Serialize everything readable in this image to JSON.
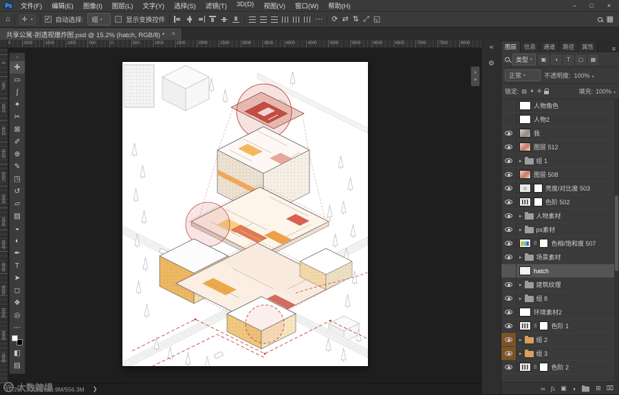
{
  "app": {
    "icon_text": "Ps",
    "menu_items": [
      {
        "id": "file",
        "label": "文件(F)"
      },
      {
        "id": "edit",
        "label": "编辑(E)"
      },
      {
        "id": "image",
        "label": "图像(I)"
      },
      {
        "id": "layer",
        "label": "图层(L)"
      },
      {
        "id": "type",
        "label": "文字(Y)"
      },
      {
        "id": "select",
        "label": "选择(S)"
      },
      {
        "id": "filter",
        "label": "滤镜(T)"
      },
      {
        "id": "3d",
        "label": "3D(D)"
      },
      {
        "id": "view",
        "label": "视图(V)"
      },
      {
        "id": "window",
        "label": "窗口(W)"
      },
      {
        "id": "help",
        "label": "帮助(H)"
      }
    ],
    "window_controls": [
      {
        "name": "minimize-button",
        "glyph": "–"
      },
      {
        "name": "maximize-button",
        "glyph": "□"
      },
      {
        "name": "close-button",
        "glyph": "×"
      }
    ]
  },
  "options_bar": {
    "home_glyph": "⌂",
    "tool_glyph": "✛",
    "auto_select_label": "自动选择:",
    "auto_select_checked": true,
    "scope_value": "组",
    "show_transform_label": "显示变换控件",
    "show_transform_checked": false,
    "more_glyph": "⋯",
    "align_icons": [
      {
        "name": "align-left-button"
      },
      {
        "name": "align-center-h-button"
      },
      {
        "name": "align-right-button"
      },
      {
        "name": "align-top-button"
      },
      {
        "name": "align-middle-button"
      },
      {
        "name": "align-bottom-button"
      }
    ],
    "distribute_icons": [
      {
        "name": "distribute-vertical-top-button"
      },
      {
        "name": "distribute-vertical-middle-button"
      },
      {
        "name": "distribute-vertical-bottom-button"
      },
      {
        "name": "distribute-horizontal-left-button"
      },
      {
        "name": "distribute-horizontal-center-button"
      },
      {
        "name": "distribute-horizontal-right-button"
      }
    ],
    "threed_icons": [
      {
        "name": "3d-rotate-icon",
        "glyph": "⟳"
      },
      {
        "name": "3d-roll-icon",
        "glyph": "⇄"
      },
      {
        "name": "3d-drag-icon",
        "glyph": "⇅"
      },
      {
        "name": "3d-slide-icon",
        "glyph": "⤢"
      },
      {
        "name": "3d-scale-icon",
        "glyph": "◱"
      }
    ],
    "right_icons": [
      {
        "name": "search-icon",
        "kind": "mag"
      },
      {
        "name": "workspace-switcher-icon",
        "glyph": "▦"
      }
    ]
  },
  "document_tab": {
    "title": "共享公寓-剖透视爆炸图.psd @ 15.2% (hatch, RGB/8) *",
    "close_glyph": "×"
  },
  "rulers": {
    "horizontal_labels": [
      "2500",
      "2000",
      "1500",
      "1000",
      "500",
      "0",
      "500",
      "1000",
      "1500",
      "2000",
      "2500",
      "3000",
      "3500",
      "4000",
      "4500",
      "5000",
      "5500",
      "6000",
      "6500",
      "7000",
      "7500",
      "8000"
    ],
    "vertical_labels": [
      "0",
      "500",
      "1000",
      "1500",
      "2000",
      "2500",
      "3000",
      "3500",
      "4000",
      "4500",
      "5000",
      "5500",
      "6000",
      "6500"
    ]
  },
  "tools": [
    {
      "name": "move-tool",
      "glyph": "✛",
      "active": true
    },
    {
      "name": "marquee-tool",
      "glyph": "▭"
    },
    {
      "name": "lasso-tool",
      "glyph": "ʃ"
    },
    {
      "name": "quick-selection-tool",
      "glyph": "✦"
    },
    {
      "name": "crop-tool",
      "glyph": "✂"
    },
    {
      "name": "frame-tool",
      "glyph": "⊠"
    },
    {
      "name": "eyedropper-tool",
      "glyph": "✐"
    },
    {
      "name": "healing-brush-tool",
      "glyph": "⊕"
    },
    {
      "name": "brush-tool",
      "glyph": "✎"
    },
    {
      "name": "clone-stamp-tool",
      "glyph": "◳"
    },
    {
      "name": "history-brush-tool",
      "glyph": "↺"
    },
    {
      "name": "eraser-tool",
      "glyph": "▱"
    },
    {
      "name": "gradient-tool",
      "glyph": "▨"
    },
    {
      "name": "blur-tool",
      "glyph": "◒"
    },
    {
      "name": "dodge-tool",
      "glyph": "◐"
    },
    {
      "name": "pen-tool",
      "glyph": "✒"
    },
    {
      "name": "type-tool",
      "glyph": "T"
    },
    {
      "name": "path-selection-tool",
      "glyph": "➤"
    },
    {
      "name": "rectangle-tool",
      "glyph": "◻"
    },
    {
      "name": "hand-tool",
      "glyph": "❖"
    },
    {
      "name": "zoom-tool",
      "glyph": "◎"
    },
    {
      "name": "edit-toolbar-button",
      "glyph": "⋯"
    },
    {
      "name": "color-swatches",
      "kind": "swatches"
    },
    {
      "name": "quick-mask-button",
      "glyph": "◧"
    },
    {
      "name": "screen-mode-button",
      "glyph": "▤"
    }
  ],
  "canvas_widget_icons": [
    {
      "name": "collapse-widget-icon",
      "glyph": "»"
    },
    {
      "name": "widget-options-icon",
      "glyph": "≡"
    }
  ],
  "panels": {
    "dock_strip": [
      {
        "name": "collapse-dock-button",
        "glyph": "«"
      },
      {
        "name": "properties-panel-icon",
        "glyph": "⚙"
      }
    ],
    "tabs": [
      {
        "label": "图层",
        "active": true
      },
      {
        "label": "信息",
        "active": false
      },
      {
        "label": "通道",
        "active": false
      },
      {
        "label": "路径",
        "active": false
      },
      {
        "label": "属性",
        "active": false
      }
    ],
    "panel_menu_glyph": "≡",
    "filter_row": {
      "type_label": "类型",
      "filters": [
        {
          "name": "pixel-filter-icon",
          "glyph": "▣"
        },
        {
          "name": "adjustment-filter-icon",
          "glyph": "◑"
        },
        {
          "name": "type-filter-icon",
          "glyph": "T"
        },
        {
          "name": "shape-filter-icon",
          "glyph": "▢"
        },
        {
          "name": "smart-object-filter-icon",
          "glyph": "▦"
        }
      ]
    },
    "blend_row": {
      "mode": "正常",
      "opacity_label": "不透明度:",
      "opacity_value": "100%"
    },
    "lock_row": {
      "label": "锁定:",
      "icons": [
        {
          "name": "lock-transparency-icon",
          "glyph": "▨"
        },
        {
          "name": "lock-paint-icon",
          "glyph": "✦"
        },
        {
          "name": "lock-position-icon",
          "glyph": "✛"
        },
        {
          "name": "lock-all-icon",
          "kind": "padlock"
        }
      ],
      "fill_label": "填充:",
      "fill_value": "100%"
    },
    "layers": [
      {
        "name": "人物角色",
        "type": "layer",
        "thumb": "white",
        "visible": false
      },
      {
        "name": "人物2",
        "type": "layer",
        "thumb": "white",
        "visible": false
      },
      {
        "name": "我",
        "type": "layer",
        "thumb": "image",
        "visible": true
      },
      {
        "name": "图层 512",
        "type": "layer",
        "thumb": "image2",
        "visible": true
      },
      {
        "name": "组 1",
        "type": "group",
        "visible": true
      },
      {
        "name": "图层 508",
        "type": "layer",
        "thumb": "image2",
        "visible": true
      },
      {
        "name": "亮度/对比度 503",
        "type": "adjustment",
        "adj": "sun",
        "mask": true,
        "visible": true
      },
      {
        "name": "色阶 502",
        "type": "adjustment",
        "adj": "levels",
        "mask": true,
        "visible": true
      },
      {
        "name": "人物素材",
        "type": "group",
        "visible": true
      },
      {
        "name": "ps素材",
        "type": "group",
        "visible": true
      },
      {
        "name": "色相/饱和度 507",
        "type": "adjustment",
        "adj": "hue",
        "mask": true,
        "linked": true,
        "visible": true
      },
      {
        "name": "场景素材",
        "type": "group",
        "visible": true
      },
      {
        "name": "hatch",
        "type": "layer",
        "thumb": "hatch",
        "visible": false,
        "selected": true
      },
      {
        "name": "建筑纹理",
        "type": "group",
        "visible": true
      },
      {
        "name": "组 8",
        "type": "group",
        "visible": true
      },
      {
        "name": "环境素材2",
        "type": "layer",
        "thumb": "white",
        "visible": true
      },
      {
        "name": "色阶 1",
        "type": "adjustment",
        "adj": "levels",
        "mask": true,
        "linked": true,
        "visible": true
      },
      {
        "name": "组 2",
        "type": "group",
        "visible": true,
        "label_color": "orange"
      },
      {
        "name": "组 3",
        "type": "group",
        "visible": true,
        "label_color": "orange"
      },
      {
        "name": "色阶 2",
        "type": "adjustment",
        "adj": "levels",
        "mask": true,
        "linked": true,
        "visible": true
      }
    ],
    "bottom_icons": [
      {
        "name": "link-layers-button",
        "glyph": "∞"
      },
      {
        "name": "layer-effects-button",
        "glyph": "fx",
        "fx": true
      },
      {
        "name": "add-layer-mask-button",
        "glyph": "▣"
      },
      {
        "name": "new-adjustment-layer-button",
        "glyph": "◑"
      },
      {
        "name": "new-group-button",
        "kind": "folder"
      },
      {
        "name": "new-layer-button",
        "glyph": "⊞"
      },
      {
        "name": "delete-layer-button",
        "glyph": "⌧"
      }
    ]
  },
  "status_bar": {
    "zoom": "15.2%",
    "doc_info": "文档:550.9M/556.3M",
    "arrow_glyph": "❯"
  },
  "watermark": {
    "logo_text": "100",
    "text": "大数跨境"
  },
  "colors": {
    "accent_red": "#c0392b",
    "artwork_orange": "#efa94a",
    "artwork_pink": "#e9a8a0",
    "artwork_yellow": "#f6cf7d",
    "panel_bg": "#3a3a3a",
    "pasteboard_bg": "#1e1e1e",
    "selection_bg": "#555555"
  }
}
